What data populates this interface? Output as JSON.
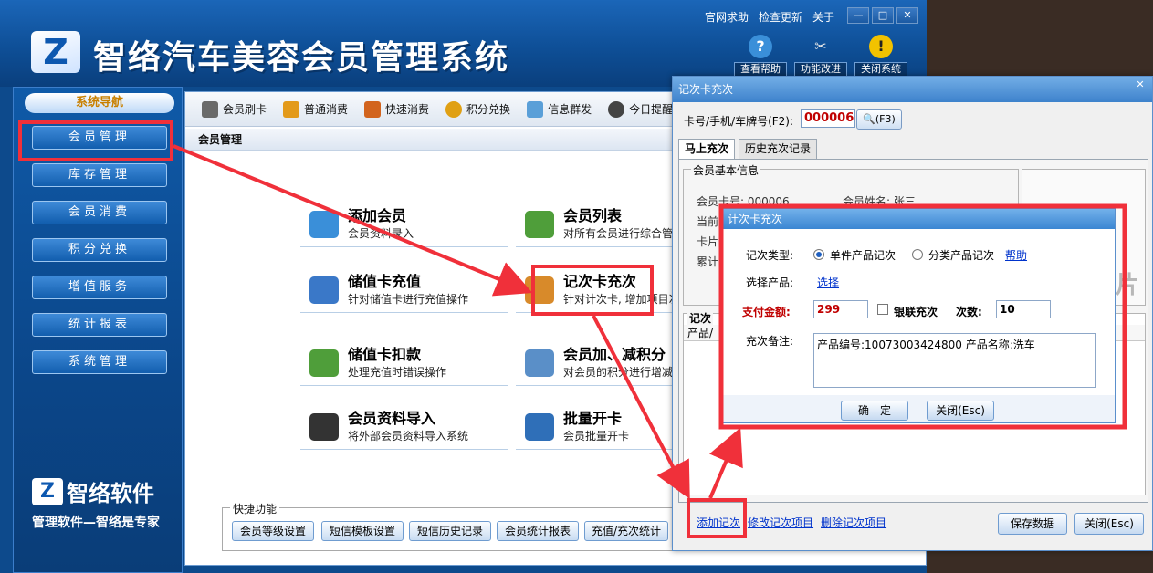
{
  "app": {
    "title": "智络汽车美容会员管理系统",
    "top_links": [
      "官网求助",
      "检查更新",
      "关于"
    ],
    "window_controls": [
      "—",
      "□",
      "✕"
    ],
    "tools": [
      {
        "label": "查看帮助",
        "icon": "help-icon",
        "glyph": "?",
        "color": "#3a8fd9"
      },
      {
        "label": "功能改进",
        "icon": "tools-icon",
        "glyph": "✂",
        "color": "#6f6f6f"
      },
      {
        "label": "关闭系统",
        "icon": "warning-icon",
        "glyph": "!",
        "color": "#f2c200"
      }
    ]
  },
  "sidebar": {
    "header": "系统导航",
    "items": [
      "会员管理",
      "库存管理",
      "会员消费",
      "积分兑换",
      "增值服务",
      "统计报表",
      "系统管理"
    ],
    "brand": "智络软件",
    "slogan": "管理软件—智络是专家"
  },
  "quickbar": [
    {
      "label": "会员刷卡",
      "icon": "card-reader-icon",
      "color": "#6a6a6a"
    },
    {
      "label": "普通消费",
      "icon": "money-bag-icon",
      "color": "#e39a1b"
    },
    {
      "label": "快速消费",
      "icon": "quick-consume-icon",
      "color": "#d2641e"
    },
    {
      "label": "积分兑换",
      "icon": "points-exchange-icon",
      "color": "#e0a014"
    },
    {
      "label": "信息群发",
      "icon": "message-icon",
      "color": "#5a9fd8"
    },
    {
      "label": "今日提醒",
      "icon": "clock-icon",
      "color": "#444444"
    }
  ],
  "breadcrumb": "会员管理",
  "functions": [
    {
      "title": "添加会员",
      "desc": "会员资料录入",
      "icon": "add-member-icon",
      "color": "#3a8fd9"
    },
    {
      "title": "会员列表",
      "desc": "对所有会员进行综合管",
      "icon": "member-list-icon",
      "color": "#4f9e3a"
    },
    {
      "title": "储值卡充值",
      "desc": "针对储值卡进行充值操作",
      "icon": "stored-card-icon",
      "color": "#3a78c8"
    },
    {
      "title": "记次卡充次",
      "desc": "针对计次卡, 增加项目次",
      "icon": "count-card-icon",
      "color": "#d88a2a"
    },
    {
      "title": "储值卡扣款",
      "desc": "处理充值时错误操作",
      "icon": "deduct-icon",
      "color": "#4f9e3a"
    },
    {
      "title": "会员加、减积分",
      "desc": "对会员的积分进行增减",
      "icon": "points-icon",
      "color": "#5a8fc8"
    },
    {
      "title": "会员资料导入",
      "desc": "将外部会员资料导入系统",
      "icon": "import-icon",
      "color": "#333333"
    },
    {
      "title": "批量开卡",
      "desc": "会员批量开卡",
      "icon": "batch-card-icon",
      "color": "#2f6fb8"
    }
  ],
  "shortcut": {
    "title": "快捷功能",
    "buttons": [
      "会员等级设置",
      "短信模板设置",
      "短信历史记录",
      "会员统计报表",
      "充值/充次统计"
    ]
  },
  "dialog": {
    "title": "记次卡充次",
    "card_label": "卡号/手机/车牌号(F2):",
    "card_value": "000006",
    "card_btn": "(F3)",
    "tabs": [
      "马上充次",
      "历史充次记录"
    ],
    "member_legend": "会员基本信息",
    "member_rows": [
      "会员卡号: 000006",
      "会员姓名: 张三",
      "当前",
      "卡片",
      "累计"
    ],
    "photo_caption": "照片",
    "records_legend": "记次",
    "records_col": "产品/",
    "links": [
      "添加记次",
      "修改记次项目",
      "删除记次项目"
    ],
    "save_btn": "保存数据",
    "close_btn": "关闭(Esc)"
  },
  "popup": {
    "title": "计次卡充次",
    "type_label": "记次类型:",
    "type_option1": "单件产品记次",
    "type_option2": "分类产品记次",
    "help_link": "帮助",
    "product_label": "选择产品:",
    "product_link": "选择",
    "pay_label": "支付金额:",
    "pay_value": "299",
    "bank_label": "银联充次",
    "times_label": "次数:",
    "times_value": "10",
    "note_label": "充次备注:",
    "note_value": "产品编号:10073003424800 产品名称:洗车",
    "ok_btn": "确　定",
    "close_btn": "关闭(Esc)"
  },
  "annotation_color": "#f0303a"
}
